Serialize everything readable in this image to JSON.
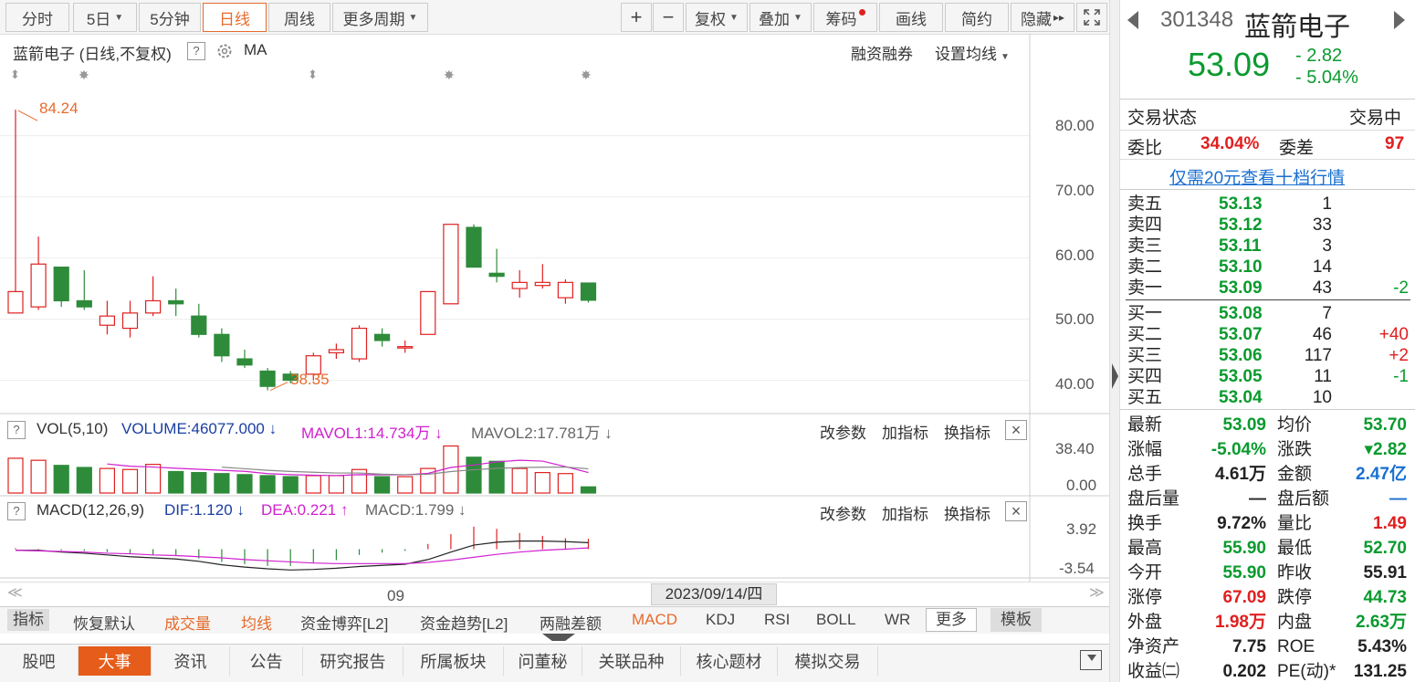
{
  "toolbar": {
    "periods": [
      "分时",
      "5日",
      "5分钟",
      "日线",
      "周线",
      "更多周期"
    ],
    "tools": [
      "复权",
      "叠加",
      "筹码",
      "画线",
      "简约",
      "隐藏"
    ],
    "plus": "+",
    "minus": "−",
    "hide_arrow": "▸▸"
  },
  "chart": {
    "title": "蓝箭电子 (日线,不复权)",
    "question": "?",
    "ma": "MA",
    "rzrq": "融资融券",
    "set_ma": "设置均线",
    "price_ticks": [
      "80.00",
      "70.00",
      "60.00",
      "50.00",
      "40.00"
    ],
    "high_label": "84.24",
    "low_label": "38.35"
  },
  "vol": {
    "label": "VOL(5,10)",
    "volume": "VOLUME:46077.000",
    "mavol1": "MAVOL1:14.734万",
    "mavol2": "MAVOL2:17.781万",
    "ticks": [
      "38.40",
      "0.00"
    ]
  },
  "macd": {
    "label": "MACD(12,26,9)",
    "dif": "DIF:1.120",
    "dea": "DEA:0.221",
    "macd": "MACD:1.799",
    "ticks": [
      "3.92",
      "-3.54"
    ]
  },
  "panel_btns": [
    "改参数",
    "加指标",
    "换指标"
  ],
  "close_glyph": "×",
  "date_axis": {
    "tick": "09",
    "cursor": "2023/09/14/四",
    "left": "≪",
    "right": "≫"
  },
  "indicator_tabs": [
    "指标",
    "恢复默认",
    "成交量",
    "均线",
    "资金博弈[L2]",
    "资金趋势[L2]",
    "两融差额",
    "MACD",
    "KDJ",
    "RSI",
    "BOLL",
    "WR",
    "更多",
    "模板"
  ],
  "bottom_tabs": [
    "股吧",
    "大事",
    "资讯",
    "公告",
    "研究报告",
    "所属板块",
    "问董秘",
    "关联品种",
    "核心题材",
    "模拟交易"
  ],
  "quote": {
    "code": "301348",
    "name": "蓝箭电子",
    "price": "53.09",
    "change": "- 2.82",
    "change_pct": "- 5.04%",
    "status_label": "交易状态",
    "status_value": "交易中",
    "weibi_label": "委比",
    "weibi": "34.04%",
    "weicha_label": "委差",
    "weicha": "97",
    "promo": "仅需20元查看十档行情",
    "sells": [
      {
        "label": "卖五",
        "price": "53.13",
        "vol": "1",
        "chg": ""
      },
      {
        "label": "卖四",
        "price": "53.12",
        "vol": "33",
        "chg": ""
      },
      {
        "label": "卖三",
        "price": "53.11",
        "vol": "3",
        "chg": ""
      },
      {
        "label": "卖二",
        "price": "53.10",
        "vol": "14",
        "chg": ""
      },
      {
        "label": "卖一",
        "price": "53.09",
        "vol": "43",
        "chg": "-2"
      }
    ],
    "buys": [
      {
        "label": "买一",
        "price": "53.08",
        "vol": "7",
        "chg": ""
      },
      {
        "label": "买二",
        "price": "53.07",
        "vol": "46",
        "chg": "+40"
      },
      {
        "label": "买三",
        "price": "53.06",
        "vol": "117",
        "chg": "+2"
      },
      {
        "label": "买四",
        "price": "53.05",
        "vol": "11",
        "chg": "-1"
      },
      {
        "label": "买五",
        "price": "53.04",
        "vol": "10",
        "chg": ""
      }
    ],
    "stats": [
      {
        "l1": "最新",
        "v1": "53.09",
        "c1": "green",
        "l2": "均价",
        "v2": "53.70",
        "c2": "green"
      },
      {
        "l1": "涨幅",
        "v1": "-5.04%",
        "c1": "green",
        "l2": "涨跌",
        "v2": "▾2.82",
        "c2": "green"
      },
      {
        "l1": "总手",
        "v1": "4.61万",
        "c1": "",
        "l2": "金额",
        "v2": "2.47亿",
        "c2": "blue"
      },
      {
        "l1": "盘后量",
        "v1": "—",
        "c1": "",
        "l2": "盘后额",
        "v2": "—",
        "c2": "blue"
      },
      {
        "l1": "换手",
        "v1": "9.72%",
        "c1": "",
        "l2": "量比",
        "v2": "1.49",
        "c2": "red"
      },
      {
        "l1": "最高",
        "v1": "55.90",
        "c1": "green",
        "l2": "最低",
        "v2": "52.70",
        "c2": "green"
      },
      {
        "l1": "今开",
        "v1": "55.90",
        "c1": "green",
        "l2": "昨收",
        "v2": "55.91",
        "c2": ""
      },
      {
        "l1": "涨停",
        "v1": "67.09",
        "c1": "red",
        "l2": "跌停",
        "v2": "44.73",
        "c2": "green"
      },
      {
        "l1": "外盘",
        "v1": "1.98万",
        "c1": "red",
        "l2": "内盘",
        "v2": "2.63万",
        "c2": "green"
      },
      {
        "l1": "净资产",
        "v1": "7.75",
        "c1": "",
        "l2": "ROE",
        "v2": "5.43%",
        "c2": ""
      },
      {
        "l1": "收益㈡",
        "v1": "0.202",
        "c1": "",
        "l2": "PE(动)*",
        "v2": "131.25",
        "c2": ""
      }
    ]
  },
  "chart_data": {
    "type": "candlestick",
    "ylim": [
      35,
      88
    ],
    "candles": [
      {
        "o": 51,
        "c": 54.5,
        "h": 84.24,
        "l": 51
      },
      {
        "o": 52,
        "c": 59,
        "h": 63.5,
        "l": 51.5
      },
      {
        "o": 58.5,
        "c": 53,
        "h": 58.5,
        "l": 52
      },
      {
        "o": 53,
        "c": 52,
        "h": 58,
        "l": 51.5
      },
      {
        "o": 49,
        "c": 50.5,
        "h": 53,
        "l": 47.5
      },
      {
        "o": 48.5,
        "c": 51,
        "h": 53,
        "l": 47
      },
      {
        "o": 51,
        "c": 53,
        "h": 57,
        "l": 50.5
      },
      {
        "o": 53,
        "c": 52.5,
        "h": 55,
        "l": 50.5
      },
      {
        "o": 50.5,
        "c": 47.5,
        "h": 52.5,
        "l": 47
      },
      {
        "o": 47.5,
        "c": 44,
        "h": 48.5,
        "l": 43
      },
      {
        "o": 43.5,
        "c": 42.5,
        "h": 45,
        "l": 42
      },
      {
        "o": 41.5,
        "c": 39,
        "h": 42,
        "l": 38.35
      },
      {
        "o": 41,
        "c": 40,
        "h": 41.5,
        "l": 39.5
      },
      {
        "o": 41,
        "c": 44,
        "h": 44.5,
        "l": 40
      },
      {
        "o": 44.5,
        "c": 45,
        "h": 46,
        "l": 43.5
      },
      {
        "o": 43.5,
        "c": 48.5,
        "h": 49,
        "l": 43
      },
      {
        "o": 47.5,
        "c": 46.5,
        "h": 48.5,
        "l": 45.5
      },
      {
        "o": 45.5,
        "c": 45.5,
        "h": 46.5,
        "l": 44.5
      },
      {
        "o": 47.5,
        "c": 54.5,
        "h": 54.5,
        "l": 47.5
      },
      {
        "o": 52.5,
        "c": 65.5,
        "h": 65.5,
        "l": 52.5
      },
      {
        "o": 65,
        "c": 58.5,
        "h": 65.5,
        "l": 58.5
      },
      {
        "o": 57.5,
        "c": 57,
        "h": 61.5,
        "l": 56
      },
      {
        "o": 55,
        "c": 56,
        "h": 58,
        "l": 53.5
      },
      {
        "o": 55.5,
        "c": 56,
        "h": 59,
        "l": 55
      },
      {
        "o": 53.5,
        "c": 56,
        "h": 56.5,
        "l": 52.5
      },
      {
        "o": 55.9,
        "c": 53.09,
        "h": 55.9,
        "l": 52.7
      }
    ],
    "volume": [
      34,
      32,
      27,
      25,
      24,
      23,
      28,
      21,
      20,
      19,
      18,
      17,
      16,
      17,
      17,
      23,
      16,
      16,
      24,
      46,
      35,
      31,
      24,
      20,
      19,
      6
    ],
    "vol_ylim": [
      0,
      50
    ],
    "macd_hist": [
      0.2,
      0.1,
      -0.2,
      -0.3,
      -0.5,
      -0.8,
      -1.0,
      -1.2,
      -1.6,
      -2.2,
      -2.6,
      -2.9,
      -2.9,
      -2.4,
      -1.9,
      -1.0,
      -0.6,
      -0.3,
      0.9,
      2.6,
      3.9,
      3.5,
      2.8,
      2.3,
      1.9,
      1.8
    ],
    "dif": [
      -0.2,
      -0.2,
      -0.5,
      -0.7,
      -1.0,
      -1.3,
      -1.5,
      -1.7,
      -2.1,
      -2.7,
      -3.1,
      -3.4,
      -3.6,
      -3.5,
      -3.3,
      -3.0,
      -2.8,
      -2.6,
      -1.8,
      -0.5,
      0.7,
      1.2,
      1.4,
      1.4,
      1.3,
      1.12
    ],
    "dea": [
      -0.2,
      -0.3,
      -0.4,
      -0.5,
      -0.7,
      -0.8,
      -1.0,
      -1.1,
      -1.3,
      -1.5,
      -1.8,
      -2.0,
      -2.2,
      -2.4,
      -2.5,
      -2.5,
      -2.5,
      -2.5,
      -2.3,
      -1.9,
      -1.4,
      -0.9,
      -0.5,
      -0.2,
      0.0,
      0.221
    ],
    "macd_ylim": [
      -4.5,
      4.5
    ]
  }
}
